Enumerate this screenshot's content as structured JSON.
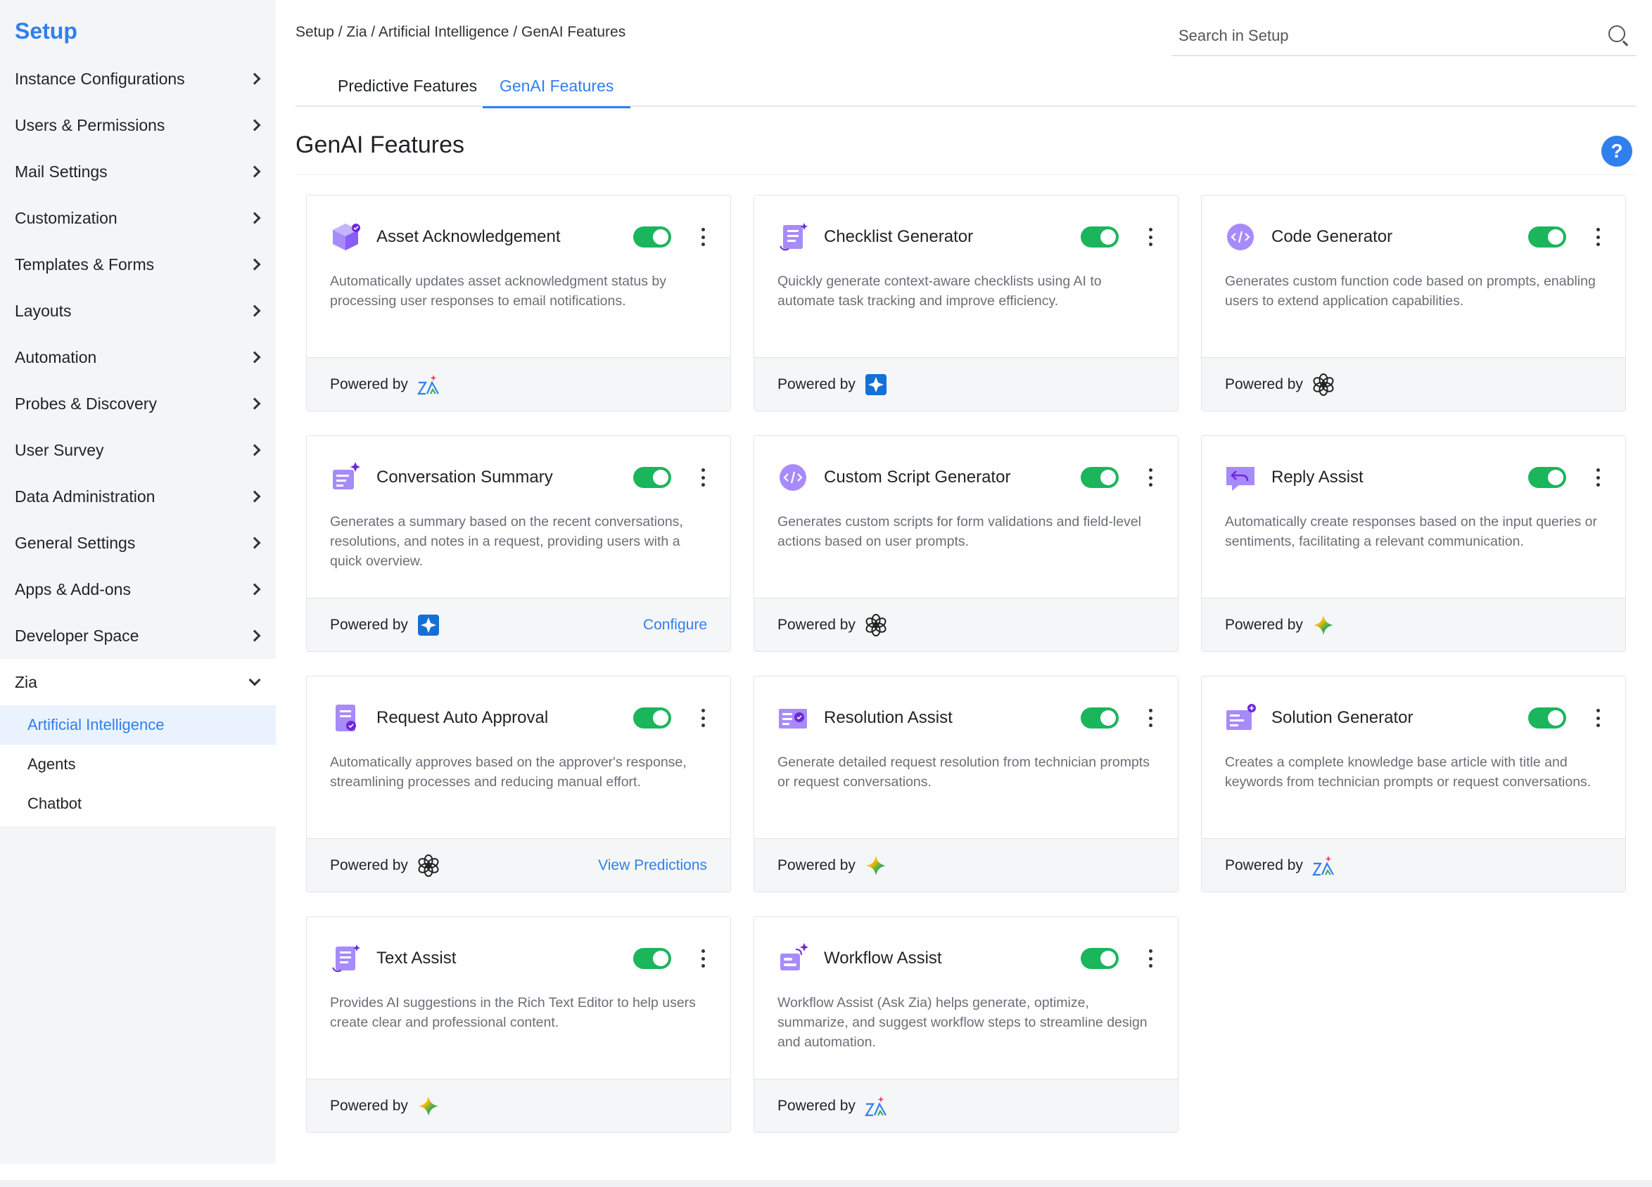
{
  "sidebar": {
    "title": "Setup",
    "items": [
      {
        "label": "Instance Configurations"
      },
      {
        "label": "Users & Permissions"
      },
      {
        "label": "Mail Settings"
      },
      {
        "label": "Customization"
      },
      {
        "label": "Templates & Forms"
      },
      {
        "label": "Layouts"
      },
      {
        "label": "Automation"
      },
      {
        "label": "Probes & Discovery"
      },
      {
        "label": "User Survey"
      },
      {
        "label": "Data Administration"
      },
      {
        "label": "General Settings"
      },
      {
        "label": "Apps & Add-ons"
      },
      {
        "label": "Developer Space"
      }
    ],
    "open_section": {
      "label": "Zia",
      "children": [
        {
          "label": "Artificial Intelligence",
          "active": true
        },
        {
          "label": "Agents"
        },
        {
          "label": "Chatbot"
        }
      ]
    }
  },
  "breadcrumb": "Setup / Zia / Artificial Intelligence / GenAI Features",
  "search": {
    "placeholder": "Search in Setup"
  },
  "tabs": [
    {
      "label": "Predictive Features",
      "active": false
    },
    {
      "label": "GenAI Features",
      "active": true
    }
  ],
  "page_title": "GenAI Features",
  "help_label": "?",
  "powered_by_label": "Powered by",
  "colors": {
    "accent": "#2f80ed",
    "toggle_on": "#1bb55c",
    "icon_purple": "#8b5cf6"
  },
  "cards": [
    {
      "title": "Asset Acknowledgement",
      "description": "Automatically updates asset acknowledgment status by processing user responses to email notifications.",
      "icon": "cube-icon",
      "provider": "zia",
      "enabled": true,
      "link": ""
    },
    {
      "title": "Checklist Generator",
      "description": "Quickly generate context-aware checklists using AI to automate task tracking and improve efficiency.",
      "icon": "checklist-icon",
      "provider": "azure",
      "enabled": true,
      "link": ""
    },
    {
      "title": "Code Generator",
      "description": "Generates custom function code based on prompts, enabling users to extend application capabilities.",
      "icon": "code-icon",
      "provider": "openai",
      "enabled": true,
      "link": ""
    },
    {
      "title": "Conversation Summary",
      "description": "Generates a summary based on the recent conversations, resolutions, and notes in a request, providing users with a quick overview.",
      "icon": "summary-icon",
      "provider": "azure",
      "enabled": true,
      "link": "Configure"
    },
    {
      "title": "Custom Script Generator",
      "description": "Generates custom scripts for form validations and field-level actions based on user prompts.",
      "icon": "script-icon",
      "provider": "openai",
      "enabled": true,
      "link": ""
    },
    {
      "title": "Reply Assist",
      "description": "Automatically create responses based on the input queries or sentiments, facilitating a relevant communication.",
      "icon": "reply-icon",
      "provider": "gemini",
      "enabled": true,
      "link": ""
    },
    {
      "title": "Request Auto Approval",
      "description": "Automatically approves based on the approver's response, streamlining processes and reducing manual effort.",
      "icon": "approval-icon",
      "provider": "openai",
      "enabled": true,
      "link": "View Predictions"
    },
    {
      "title": "Resolution Assist",
      "description": "Generate detailed request resolution from technician prompts or request conversations.",
      "icon": "resolution-icon",
      "provider": "gemini",
      "enabled": true,
      "link": ""
    },
    {
      "title": "Solution Generator",
      "description": "Creates a complete knowledge base article with title and keywords from technician prompts or request conversations.",
      "icon": "solution-icon",
      "provider": "zia",
      "enabled": true,
      "link": ""
    },
    {
      "title": "Text Assist",
      "description": "Provides AI suggestions in the Rich Text Editor to help users create clear and professional content.",
      "icon": "text-icon",
      "provider": "gemini",
      "enabled": true,
      "link": ""
    },
    {
      "title": "Workflow Assist",
      "description": "Workflow Assist (Ask Zia) helps generate, optimize, summarize, and suggest workflow steps to streamline design and automation.",
      "icon": "workflow-icon",
      "provider": "zia",
      "enabled": true,
      "link": ""
    }
  ]
}
